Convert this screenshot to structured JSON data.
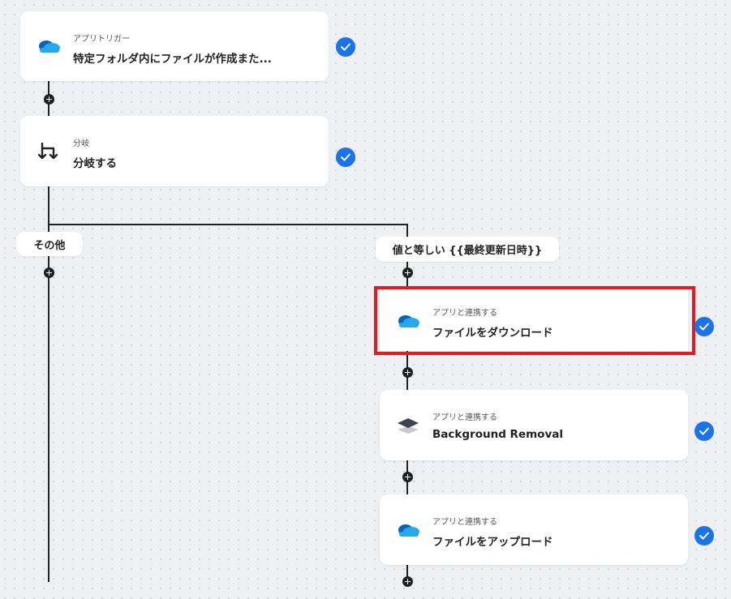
{
  "steps": [
    {
      "subtitle": "アプリトリガー",
      "title": "特定フォルダ内にファイルが作成また...",
      "icon": "onedrive-cloud-icon"
    },
    {
      "subtitle": "分岐",
      "title": "分岐する",
      "icon": "branch-icon"
    },
    {
      "subtitle": "アプリと連携する",
      "title": "ファイルをダウンロード",
      "icon": "onedrive-cloud-icon"
    },
    {
      "subtitle": "アプリと連携する",
      "title": "Background Removal",
      "icon": "layers-icon"
    },
    {
      "subtitle": "アプリと連携する",
      "title": "ファイルをアップロード",
      "icon": "onedrive-cloud-icon"
    }
  ],
  "branches": {
    "left_label": "その他",
    "right_label": "値と等しい {{最終更新日時}}"
  },
  "colors": {
    "check": "#1a73e8",
    "highlight": "#e11b22",
    "cloud_dark": "#0364b8",
    "cloud_light": "#28a8ea"
  }
}
